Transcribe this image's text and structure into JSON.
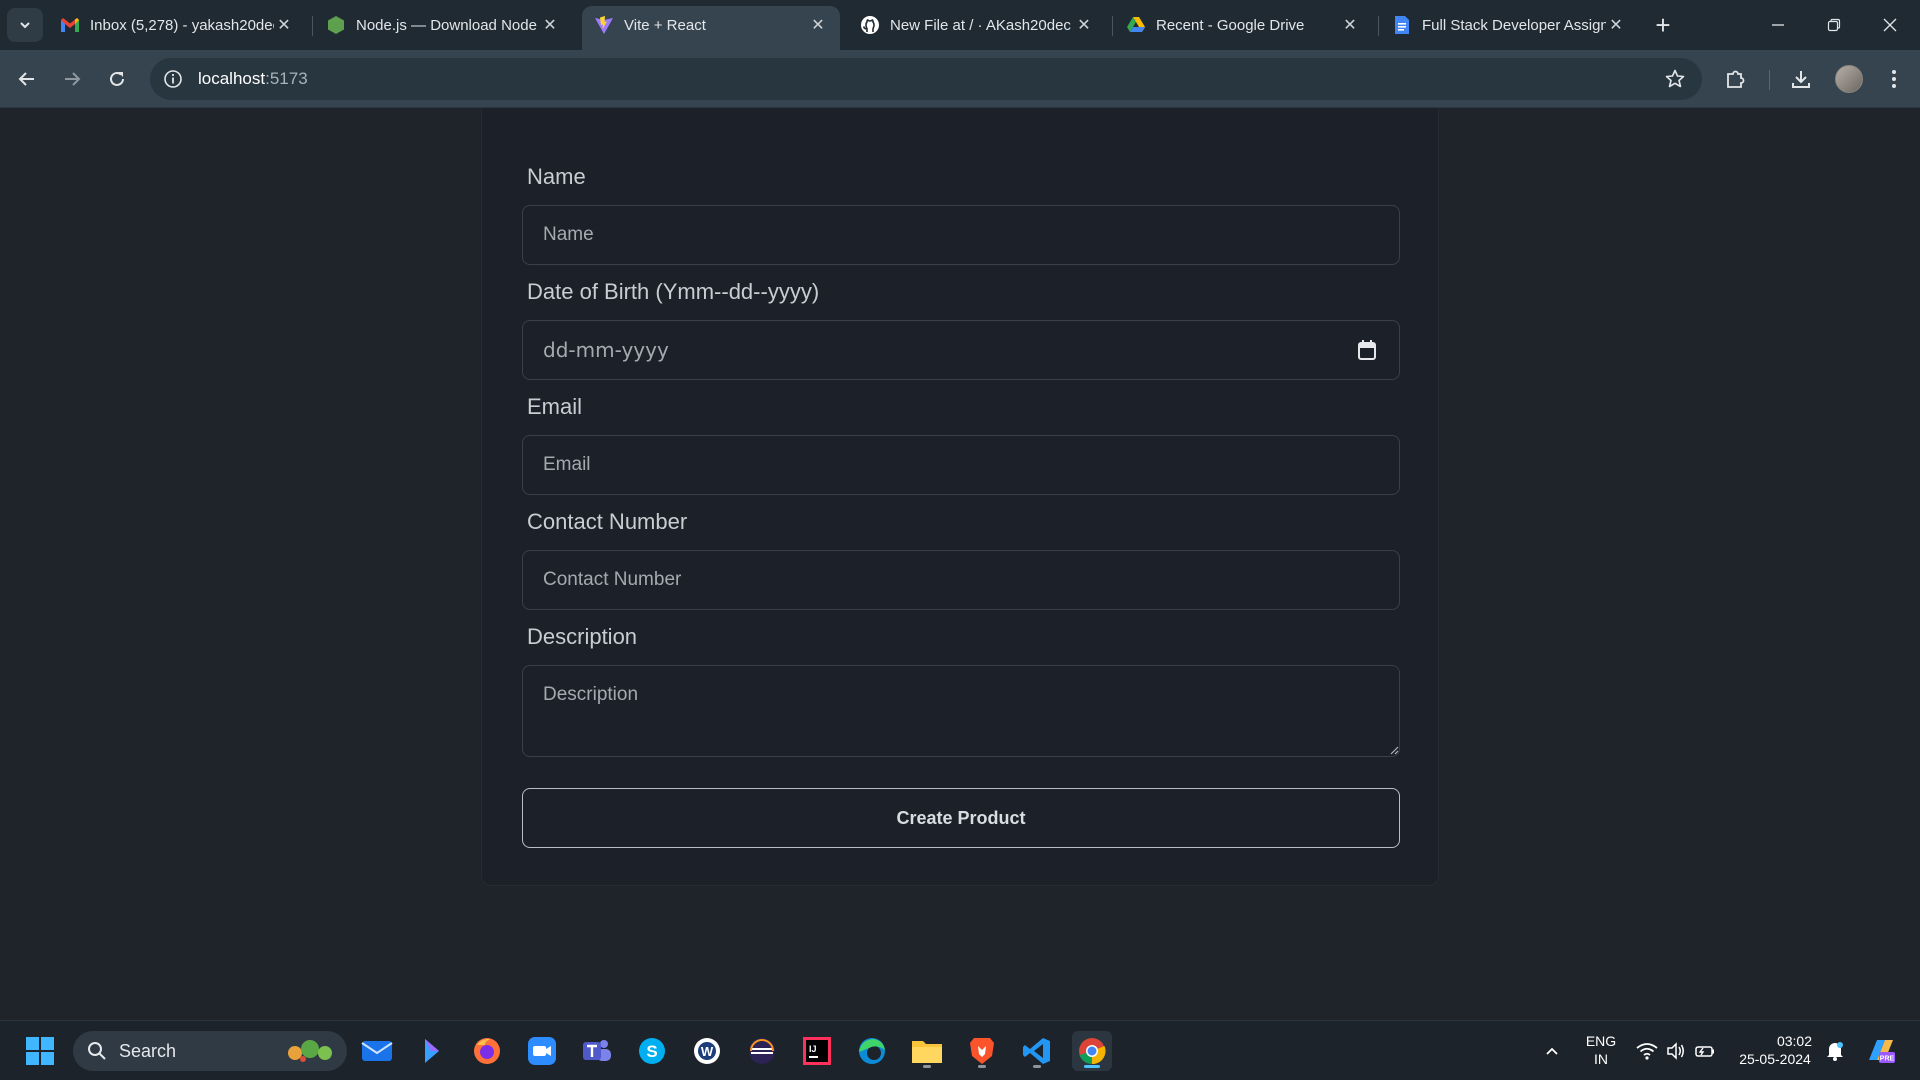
{
  "browser": {
    "tabs": [
      {
        "title": "Inbox (5,278) - yakash20dec",
        "icon": "gmail-icon",
        "active": false
      },
      {
        "title": "Node.js — Download Node",
        "icon": "nodejs-icon",
        "active": false
      },
      {
        "title": "Vite + React",
        "icon": "vite-icon",
        "active": true
      },
      {
        "title": "New File at / · AKash20dec",
        "icon": "github-icon",
        "active": false
      },
      {
        "title": "Recent - Google Drive",
        "icon": "google-drive-icon",
        "active": false
      },
      {
        "title": "Full Stack Developer Assign",
        "icon": "google-docs-icon",
        "active": false
      }
    ],
    "address": {
      "host": "localhost",
      "port": ":5173"
    }
  },
  "form": {
    "name_label": "Name",
    "name_placeholder": "Name",
    "dob_label": "Date of Birth (Ymm--dd--yyyy)",
    "dob_placeholder": "dd-mm-yyyy",
    "email_label": "Email",
    "email_placeholder": "Email",
    "contact_label": "Contact Number",
    "contact_placeholder": "Contact Number",
    "description_label": "Description",
    "description_placeholder": "Description",
    "submit_label": "Create Product"
  },
  "taskbar": {
    "search_label": "Search",
    "language_line1": "ENG",
    "language_line2": "IN",
    "time": "03:02",
    "date": "25-05-2024"
  },
  "colors": {
    "page_background": "#1f232a",
    "card_background": "#1c2028",
    "browser_toolbar": "#35444f",
    "accent": "#4cc2ff"
  }
}
